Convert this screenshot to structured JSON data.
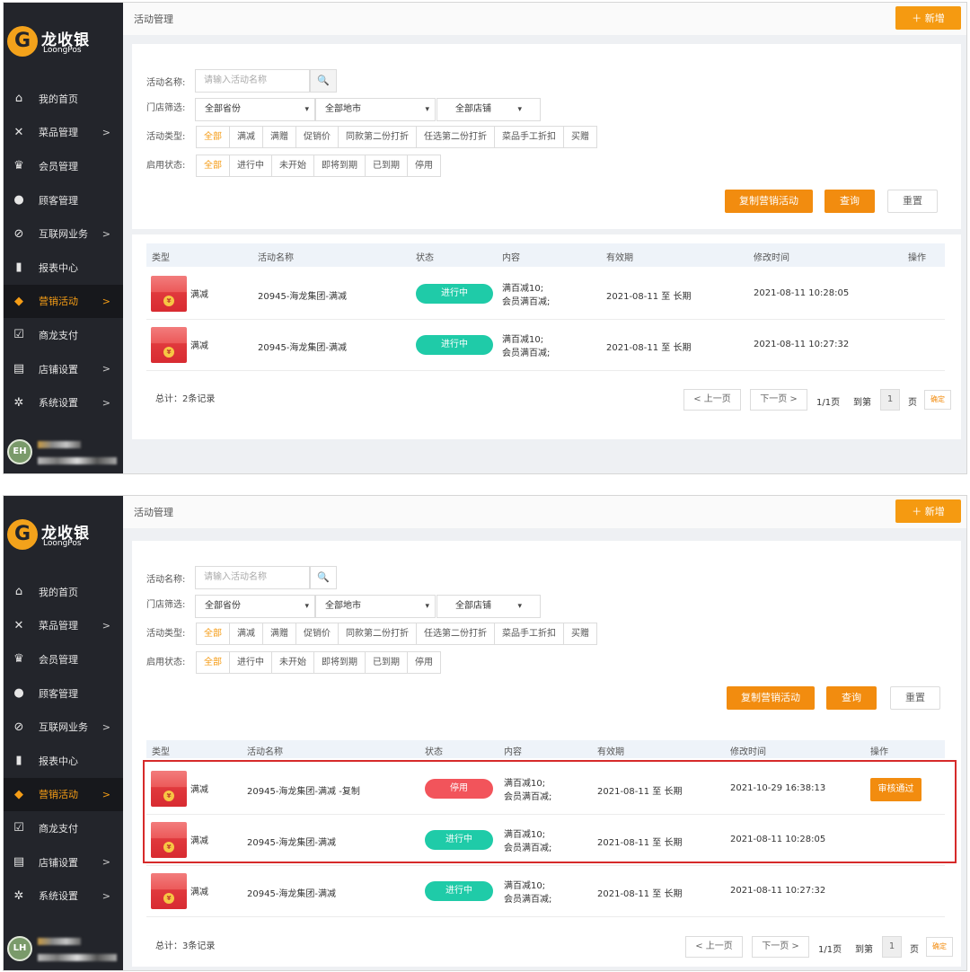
{
  "brand": {
    "name": "龙收银",
    "sub": "LoongPos",
    "mark": "G"
  },
  "menu": [
    {
      "icon": "⌂",
      "label": "我的首页",
      "arrow": ""
    },
    {
      "icon": "✕",
      "label": "菜品管理",
      "arrow": ">"
    },
    {
      "icon": "♛",
      "label": "会员管理",
      "arrow": ""
    },
    {
      "icon": "●",
      "label": "顾客管理",
      "arrow": ""
    },
    {
      "icon": "⊘",
      "label": "互联网业务",
      "arrow": ">"
    },
    {
      "icon": "▮",
      "label": "报表中心",
      "arrow": ""
    },
    {
      "icon": "◆",
      "label": "营销活动",
      "arrow": ">"
    },
    {
      "icon": "☑",
      "label": "商龙支付",
      "arrow": ""
    },
    {
      "icon": "▤",
      "label": "店铺设置",
      "arrow": ">"
    },
    {
      "icon": "✲",
      "label": "系统设置",
      "arrow": ">"
    }
  ],
  "colors": {
    "accent": "#f59a11",
    "sidebar": "#23252b",
    "green": "#1fcba8",
    "red": "#f2545b",
    "highlight": "#d62a2a"
  },
  "header": {
    "title": "活动管理",
    "add_label": "＋ 新增"
  },
  "filters": {
    "name_label": "活动名称:",
    "name_placeholder": "请输入活动名称",
    "search_icon": "🔍",
    "store_label": "门店筛选:",
    "province": "全部省份",
    "city": "全部地市",
    "store": "全部店铺",
    "type_label": "活动类型:",
    "types": [
      "全部",
      "满减",
      "满赠",
      "促销价",
      "同款第二份打折",
      "任选第二份打折",
      "菜品手工折扣",
      "买赠"
    ],
    "status_label": "启用状态:",
    "statuses": [
      "全部",
      "进行中",
      "未开始",
      "即将到期",
      "已到期",
      "停用"
    ],
    "copy_label": "复制营销活动",
    "query_label": "查询",
    "reset_label": "重置"
  },
  "table": {
    "headers": [
      "类型",
      "活动名称",
      "状态",
      "内容",
      "有效期",
      "修改时间",
      "操作"
    ]
  },
  "screen1": {
    "user_initials": "EH",
    "rows": [
      {
        "type": "满减",
        "name": "20945-海龙集团-满减",
        "status": "进行中",
        "content1": "满百减10;",
        "content2": "会员满百减;",
        "period": "2021-08-11 至 长期",
        "modified": "2021-08-11 10:28:05"
      },
      {
        "type": "满减",
        "name": "20945-海龙集团-满减",
        "status": "进行中",
        "content1": "满百减10;",
        "content2": "会员满百减;",
        "period": "2021-08-11 至 长期",
        "modified": "2021-08-11 10:27:32"
      }
    ],
    "total": "总计：2条记录"
  },
  "screen2": {
    "user_initials": "LH",
    "rows": [
      {
        "type": "满减",
        "name": "20945-海龙集团-满减 -复制",
        "status": "停用",
        "content1": "满百减10;",
        "content2": "会员满百减;",
        "period": "2021-08-11 至 长期",
        "modified": "2021-10-29 16:38:13",
        "action": "审核通过"
      },
      {
        "type": "满减",
        "name": "20945-海龙集团-满减",
        "status": "进行中",
        "content1": "满百减10;",
        "content2": "会员满百减;",
        "period": "2021-08-11 至 长期",
        "modified": "2021-08-11 10:28:05"
      },
      {
        "type": "满减",
        "name": "20945-海龙集团-满减",
        "status": "进行中",
        "content1": "满百减10;",
        "content2": "会员满百减;",
        "period": "2021-08-11 至 长期",
        "modified": "2021-08-11 10:27:32"
      }
    ],
    "total": "总计：3条记录"
  },
  "pagination": {
    "prev": "< 上一页",
    "next": "下一页 >",
    "pages": "1/1页",
    "goto": "到第",
    "page_value": "1",
    "page_unit": "页",
    "confirm": "确定"
  },
  "coin_glyph": "¥"
}
